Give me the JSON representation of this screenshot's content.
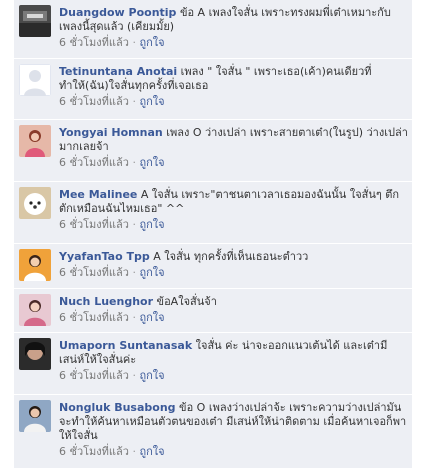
{
  "comments": [
    {
      "name": "Duangdow Poontip",
      "text": "ข้อ A เพลงใจสั่น เพราะทรงผมพี่เต๋าเหมาะกับเพลงนี้สุดแล้ว (เคียมมั้ย)",
      "time": "6 ชั่วโมงที่แล้ว",
      "like": "ถูกใจ",
      "avatar_icon": "profile-photo-dark"
    },
    {
      "name": "Tetinuntana Anotai",
      "text": "เพลง \" ใจสั่น \" เพราะเธอ(เค้า)คนเดียวที่ทำให้(ฉัน)ใจสั่นทุกครั้งที่เจอเธอ",
      "time": "6 ชั่วโมงที่แล้ว",
      "like": "ถูกใจ",
      "avatar_icon": "default-silhouette"
    },
    {
      "name": "Yongyai Homnan",
      "text": "เพลง O ว่างเปล่า เพราะสายตาเต๋า(ในรูป) ว่างเปล่ามากเลยจ้า",
      "time": "6 ชั่วโมงที่แล้ว",
      "like": "ถูกใจ",
      "avatar_icon": "profile-photo-pink"
    },
    {
      "name": "Mee Malinee",
      "text": "A ใจสั่น เพราะ\"ตาชนตาเวลาเธอมองฉันนั้น ใจสั่นๆ ตึกตักเหมือนฉันไหมเธอ\" ^^",
      "time": "6 ชั่วโมงที่แล้ว",
      "like": "ถูกใจ",
      "avatar_icon": "profile-photo-dog"
    },
    {
      "name": "YyafanTao Tpp",
      "text": "A ใจสั่น ทุกครั้งที่เห็นเธอนะตำวว",
      "time": "6 ชั่วโมงที่แล้ว",
      "like": "ถูกใจ",
      "avatar_icon": "profile-photo-orange"
    },
    {
      "name": "Nuch Luenghor",
      "text": "ข้อAใจสั่นจ้า",
      "time": "6 ชั่วโมงที่แล้ว",
      "like": "ถูกใจ",
      "avatar_icon": "profile-photo-rose"
    },
    {
      "name": "Umaporn Suntanasak",
      "text": "ใจสั่น ค่ะ น่าจะออกแนวเต้นได้ และเต๋ามีเสน่ห์ให้ใจสั่นค่ะ",
      "time": "6 ชั่วโมงที่แล้ว",
      "like": "ถูกใจ",
      "avatar_icon": "profile-photo-face"
    },
    {
      "name": "Nongluk Busabong",
      "text": "ข้อ O เพลงว่างเปล่าจ้ะ เพราะความว่างเปล่ามันจะทำให้ค้นหาเหมือนตัวตนของเต๋า มีเสน่ห์ให้น่าติดตาม เมื่อค้นหาเจอก็พาให้ใจสั่น",
      "time": "6 ชั่วโมงที่แล้ว",
      "like": "ถูกใจ",
      "avatar_icon": "profile-photo-blue"
    }
  ]
}
